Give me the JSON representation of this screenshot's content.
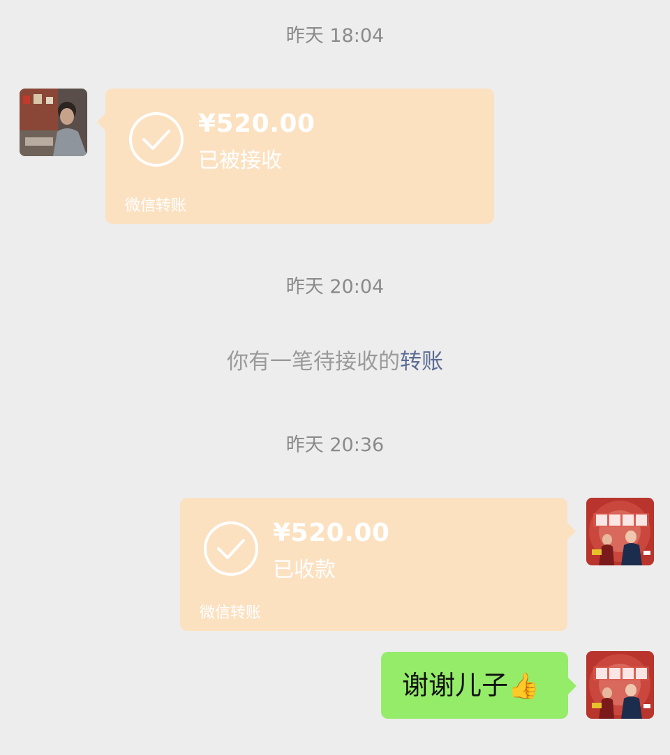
{
  "messages": {
    "time1": "昨天 18:04",
    "transfer1": {
      "amount": "¥520.00",
      "status": "已被接收",
      "label": "微信转账"
    },
    "time2": "昨天 20:04",
    "notice": {
      "text": "你有一笔待接收的",
      "link": "转账"
    },
    "time3": "昨天 20:36",
    "transfer2": {
      "amount": "¥520.00",
      "status": "已收款",
      "label": "微信转账"
    },
    "text_msg": {
      "text": "谢谢儿子",
      "emoji": "👍"
    }
  },
  "colors": {
    "background": "#ededed",
    "transfer_bubble": "#fce1c1",
    "text_bubble": "#95ec69",
    "link": "#5b6b94"
  },
  "icons": [
    "check-circle-icon",
    "thumbs-up-emoji"
  ]
}
